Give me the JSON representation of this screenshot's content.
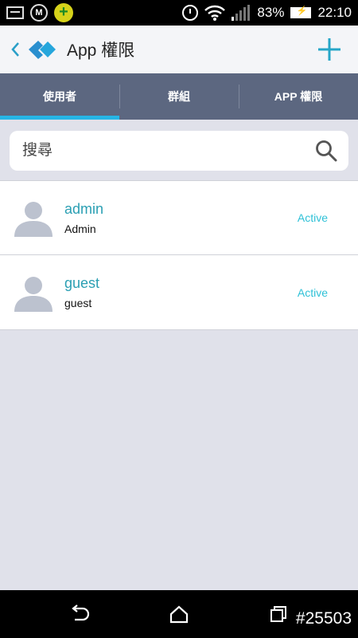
{
  "status_bar": {
    "battery": "83%",
    "time": "22:10"
  },
  "app_bar": {
    "title": "App 權限"
  },
  "tabs": [
    {
      "label": "使用者",
      "active": true
    },
    {
      "label": "群組",
      "active": false
    },
    {
      "label": "APP 權限",
      "active": false
    }
  ],
  "search": {
    "placeholder": "搜尋"
  },
  "users": [
    {
      "name": "admin",
      "role": "Admin",
      "status": "Active"
    },
    {
      "name": "guest",
      "role": "guest",
      "status": "Active"
    }
  ],
  "nav_bar": {
    "watermark": "#25503"
  },
  "colors": {
    "accent": "#26b5e5",
    "tab_bg": "#5c6780",
    "name_text": "#2a9fb3",
    "status_text": "#2fc1d7",
    "content_bg": "#e0e1ea"
  }
}
